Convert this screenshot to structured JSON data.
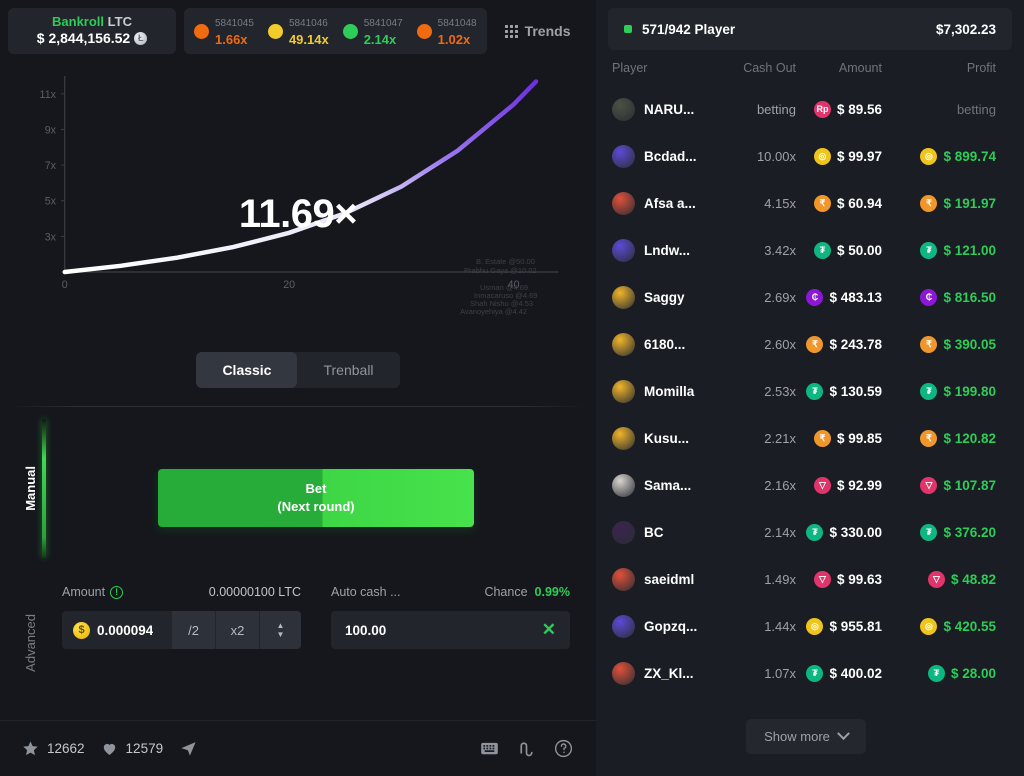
{
  "bankroll": {
    "label": "Bankroll",
    "currency": "LTC",
    "amount": "$ 2,844,156.52",
    "coin_icon": "litecoin-coin-icon"
  },
  "history": [
    {
      "id": "5841045",
      "multiplier": "1.66x",
      "color": "#f06a10"
    },
    {
      "id": "5841046",
      "multiplier": "49.14x",
      "color": "#f2cb2d"
    },
    {
      "id": "5841047",
      "multiplier": "2.14x",
      "color": "#2ecc58"
    },
    {
      "id": "5841048",
      "multiplier": "1.02x",
      "color": "#f06a10"
    }
  ],
  "trends": {
    "label": "Trends",
    "icon": "dot-grid-icon"
  },
  "chart_data": {
    "type": "line",
    "title": "",
    "current_multiplier": "11.69×",
    "xlabel": "",
    "ylabel": "",
    "x": [
      0,
      5,
      10,
      15,
      20,
      25,
      30,
      35,
      40,
      42
    ],
    "y": [
      1.0,
      1.35,
      1.8,
      2.4,
      3.2,
      4.3,
      5.8,
      7.8,
      10.4,
      11.69
    ],
    "xticks": [
      "0",
      "20",
      "40"
    ],
    "yticks": [
      "3x",
      "5x",
      "7x",
      "9x",
      "11x"
    ],
    "xlim": [
      0,
      44
    ],
    "ylim": [
      1,
      12
    ],
    "grid": false,
    "line_color_start": "#ffffff",
    "line_color_end": "#6d2ee0",
    "legend": "none",
    "annotations": [
      "B. Estate @50.00",
      "Prabhu Gaya @10.02",
      "Usman @4.69",
      "Inmacaruso @4.69",
      "Shah Nishu @4.53",
      "Avanoyehiya @4.42"
    ]
  },
  "modes": [
    {
      "label": "Classic",
      "active": true
    },
    {
      "label": "Trenball",
      "active": false
    }
  ],
  "bet_tabs": [
    {
      "label": "Manual",
      "active": true
    },
    {
      "label": "Advanced",
      "active": false
    }
  ],
  "bet_button": {
    "line1": "Bet",
    "line2": "(Next round)"
  },
  "amount_field": {
    "label": "Amount",
    "info_icon": "info-icon",
    "min_value": "0.00000100 LTC",
    "value": "0.000094",
    "coin_icon": "dollar-coin-icon",
    "half_button": "/2",
    "double_button": "x2",
    "stepper_icon": "stepper-up-down-icon"
  },
  "autocash_field": {
    "label": "Auto cash ...",
    "chance_label": "Chance",
    "chance_value": "0.99%",
    "value": "100.00",
    "clear_icon": "close-x-icon"
  },
  "statusbar": {
    "favorites": "12662",
    "likes": "12579",
    "star_icon": "star-icon",
    "heart_icon": "heart-icon",
    "share_icon": "send-icon",
    "keyboard_icon": "keyboard-icon",
    "network_icon": "fairness-curve-icon",
    "help_icon": "help-circle-icon"
  },
  "players_panel": {
    "count": "571/942 Player",
    "total": "$7,302.23",
    "columns": [
      "Player",
      "Cash Out",
      "Amount",
      "Profit"
    ],
    "show_more": "Show more",
    "show_more_icon": "chevron-down-icon",
    "rows": [
      {
        "name": "NARU...",
        "cashout": "betting",
        "amount": "$ 89.56",
        "profit": "betting",
        "profit_state": "betting",
        "coin": "Rp",
        "coin_bg": "#e0356b",
        "avatar_bg": "#4a5244"
      },
      {
        "name": "Bcdad...",
        "cashout": "10.00x",
        "amount": "$ 99.97",
        "profit": "$ 899.74",
        "profit_state": "win",
        "coin": "◎",
        "coin_bg": "#f0c419",
        "avatar_bg": "#5b4bd6"
      },
      {
        "name": "Afsa a...",
        "cashout": "4.15x",
        "amount": "$ 60.94",
        "profit": "$ 191.97",
        "profit_state": "win",
        "coin": "₹",
        "coin_bg": "#f0962a",
        "avatar_bg": "#e0503a"
      },
      {
        "name": "Lndw...",
        "cashout": "3.42x",
        "amount": "$ 50.00",
        "profit": "$ 121.00",
        "profit_state": "win",
        "coin": "₮",
        "coin_bg": "#0eb681",
        "avatar_bg": "#5b4bd6"
      },
      {
        "name": "Saggy",
        "cashout": "2.69x",
        "amount": "$ 483.13",
        "profit": "$ 816.50",
        "profit_state": "win",
        "coin": "₵",
        "coin_bg": "#8b18d4",
        "avatar_bg": "#f0b429"
      },
      {
        "name": "6180...",
        "cashout": "2.60x",
        "amount": "$ 243.78",
        "profit": "$ 390.05",
        "profit_state": "win",
        "coin": "₹",
        "coin_bg": "#f0962a",
        "avatar_bg": "#f0b429"
      },
      {
        "name": "Momilla",
        "cashout": "2.53x",
        "amount": "$ 130.59",
        "profit": "$ 199.80",
        "profit_state": "win",
        "coin": "₮",
        "coin_bg": "#0eb681",
        "avatar_bg": "#f0b429"
      },
      {
        "name": "Kusu...",
        "cashout": "2.21x",
        "amount": "$ 99.85",
        "profit": "$ 120.82",
        "profit_state": "win",
        "coin": "₹",
        "coin_bg": "#f0962a",
        "avatar_bg": "#f0b429"
      },
      {
        "name": "Sama...",
        "cashout": "2.16x",
        "amount": "$ 92.99",
        "profit": "$ 107.87",
        "profit_state": "win",
        "coin": "▽",
        "coin_bg": "#e0356b",
        "avatar_bg": "#d8d4cf"
      },
      {
        "name": "BC",
        "cashout": "2.14x",
        "amount": "$ 330.00",
        "profit": "$ 376.20",
        "profit_state": "win",
        "coin": "₮",
        "coin_bg": "#0eb681",
        "avatar_bg": "#3b2450"
      },
      {
        "name": "saeidml",
        "cashout": "1.49x",
        "amount": "$ 99.63",
        "profit": "$ 48.82",
        "profit_state": "win",
        "coin": "▽",
        "coin_bg": "#e0356b",
        "avatar_bg": "#e0503a"
      },
      {
        "name": "Gopzq...",
        "cashout": "1.44x",
        "amount": "$ 955.81",
        "profit": "$ 420.55",
        "profit_state": "win",
        "coin": "◎",
        "coin_bg": "#f0c419",
        "avatar_bg": "#5b4bd6"
      },
      {
        "name": "ZX_Kl...",
        "cashout": "1.07x",
        "amount": "$ 400.02",
        "profit": "$ 28.00",
        "profit_state": "win",
        "coin": "₮",
        "coin_bg": "#0eb681",
        "avatar_bg": "#e0503a"
      }
    ]
  }
}
